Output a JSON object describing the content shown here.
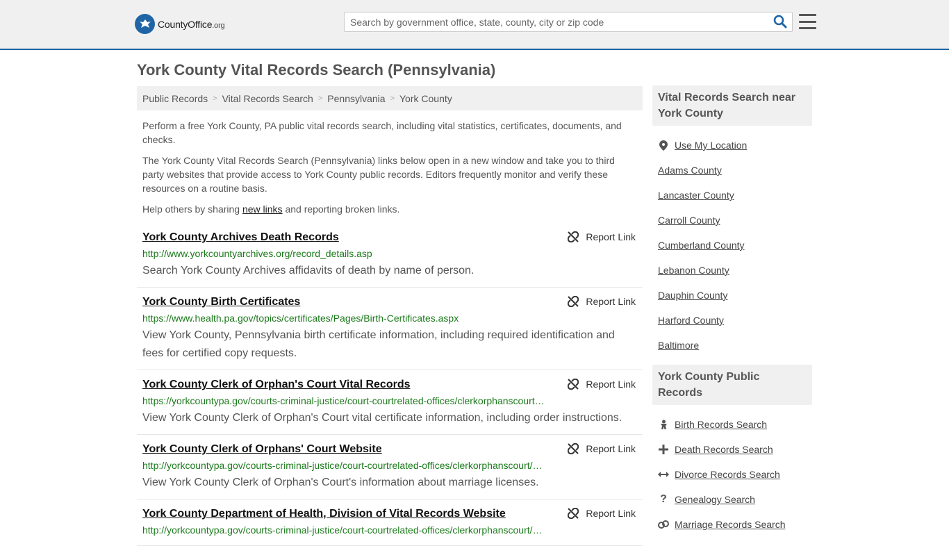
{
  "header": {
    "logo_county": "County",
    "logo_office": "Office",
    "logo_org": ".org",
    "search_placeholder": "Search by government office, state, county, city or zip code"
  },
  "page_title": "York County Vital Records Search (Pennsylvania)",
  "breadcrumb": [
    "Public Records",
    "Vital Records Search",
    "Pennsylvania",
    "York County"
  ],
  "intro": {
    "p1": "Perform a free York County, PA public vital records search, including vital statistics, certificates, documents, and checks.",
    "p2": "The York County Vital Records Search (Pennsylvania) links below open in a new window and take you to third party websites that provide access to York County public records. Editors frequently monitor and verify these resources on a routine basis.",
    "p3_before": "Help others by sharing ",
    "p3_link": "new links",
    "p3_after": " and reporting broken links."
  },
  "report_label": "Report Link",
  "results": [
    {
      "title": "York County Archives Death Records",
      "url": "http://www.yorkcountyarchives.org/record_details.asp",
      "desc": "Search York County Archives affidavits of death by name of person."
    },
    {
      "title": "York County Birth Certificates",
      "url": "https://www.health.pa.gov/topics/certificates/Pages/Birth-Certificates.aspx",
      "desc": "View York County, Pennsylvania birth certificate information, including required identification and fees for certified copy requests."
    },
    {
      "title": "York County Clerk of Orphan's Court Vital Records",
      "url": "https://yorkcountypa.gov/courts-criminal-justice/court-courtrelated-offices/clerkorphanscourt…",
      "desc": "View York County Clerk of Orphan's Court vital certificate information, including order instructions."
    },
    {
      "title": "York County Clerk of Orphans' Court Website",
      "url": "http://yorkcountypa.gov/courts-criminal-justice/court-courtrelated-offices/clerkorphanscourt/…",
      "desc": "View York County Clerk of Orphan's Court's information about marriage licenses."
    },
    {
      "title": "York County Department of Health, Division of Vital Records Website",
      "url": "http://yorkcountypa.gov/courts-criminal-justice/court-courtrelated-offices/clerkorphanscourt/…",
      "desc": ""
    }
  ],
  "sidebar": {
    "near_title": "Vital Records Search near York County",
    "near_items": [
      "Use My Location",
      "Adams County",
      "Lancaster County",
      "Carroll County",
      "Cumberland County",
      "Lebanon County",
      "Dauphin County",
      "Harford County",
      "Baltimore"
    ],
    "public_title": "York County Public Records",
    "public_items": [
      {
        "label": "Birth Records Search",
        "icon": "baby-icon"
      },
      {
        "label": "Death Records Search",
        "icon": "cross-icon"
      },
      {
        "label": "Divorce Records Search",
        "icon": "split-arrows-icon"
      },
      {
        "label": "Genealogy Search",
        "icon": "question-icon"
      },
      {
        "label": "Marriage Records Search",
        "icon": "rings-icon"
      }
    ]
  },
  "colors": {
    "brand_blue": "#1f65a6",
    "url_green": "#1b7a1b",
    "panel_gray": "#f0f0f0"
  }
}
